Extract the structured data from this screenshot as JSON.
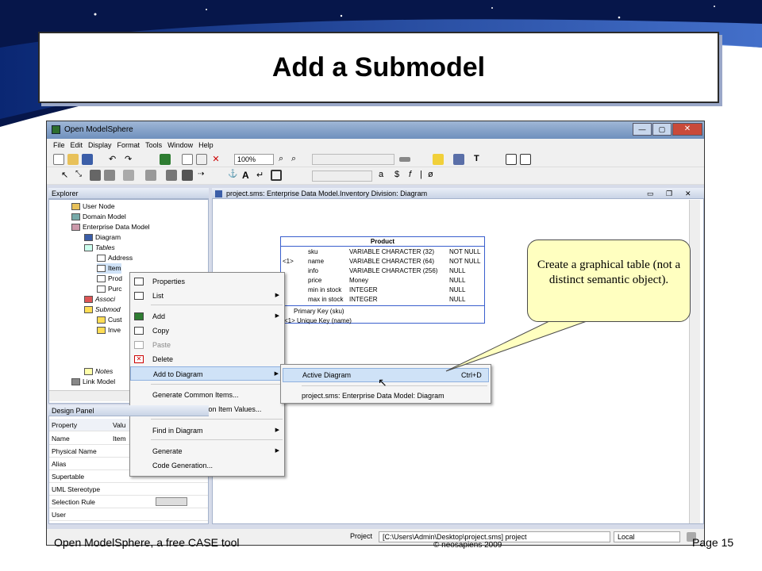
{
  "slide": {
    "title": "Add a Submodel",
    "footer_left": "Open ModelSphere, a free CASE tool",
    "footer_center": "© neosapiens 2009",
    "footer_right": "Page 15"
  },
  "app": {
    "window_title": "Open ModelSphere",
    "menu": [
      "File",
      "Edit",
      "Display",
      "Format",
      "Tools",
      "Window",
      "Help"
    ],
    "zoom": "100%",
    "text_tools": [
      "a",
      "$",
      "f",
      "|",
      "ø"
    ],
    "explorer_title": "Explorer",
    "tree": [
      "User Node",
      "Domain Model",
      "Enterprise Data Model",
      "Diagram",
      "Tables",
      "Address",
      "Item",
      "Prod",
      "Purc",
      "Associ",
      "Submod",
      "Cust",
      "Inve",
      "Notes",
      "Link Model"
    ],
    "design_panel_title": "Design Panel",
    "design_panel": {
      "headers": [
        "Property",
        "Valu"
      ],
      "rows": [
        {
          "name": "Name",
          "value": "Item"
        },
        {
          "name": "Physical Name",
          "value": ""
        },
        {
          "name": "Alias",
          "value": ""
        },
        {
          "name": "Supertable",
          "value": ""
        },
        {
          "name": "UML Stereotype",
          "value": ""
        },
        {
          "name": "Selection Rule",
          "value": ""
        },
        {
          "name": "User",
          "value": ""
        }
      ]
    },
    "diagram_tab": "project.sms: Enterprise Data Model.Inventory Division: Diagram",
    "product_table": {
      "name": "Product",
      "columns": [
        {
          "key": "",
          "name": "sku",
          "type": "VARIABLE CHARACTER (32)",
          "null": "NOT NULL"
        },
        {
          "key": "<1>",
          "name": "name",
          "type": "VARIABLE CHARACTER (64)",
          "null": "NOT NULL"
        },
        {
          "key": "",
          "name": "info",
          "type": "VARIABLE CHARACTER (256)",
          "null": "NULL"
        },
        {
          "key": "",
          "name": "price",
          "type": "Money",
          "null": "NULL"
        },
        {
          "key": "",
          "name": "min in stock",
          "type": "INTEGER",
          "null": "NULL"
        },
        {
          "key": "",
          "name": "max in stock",
          "type": "INTEGER",
          "null": "NULL"
        }
      ],
      "primary_key": "Primary Key (sku)",
      "unique_key": "<1> Unique Key (name)"
    },
    "context_menu": [
      "Properties",
      "List",
      "Add",
      "Copy",
      "Paste",
      "Delete",
      "Add to Diagram",
      "Generate Common Items...",
      "Propagate Common Item Values...",
      "Find in Diagram",
      "Generate",
      "Code Generation..."
    ],
    "submenu": {
      "active_label": "Active Diagram",
      "active_shortcut": "Ctrl+D",
      "other_label": "project.sms: Enterprise Data Model: Diagram"
    },
    "status": {
      "project_label": "Project",
      "project_path": "[C:\\Users\\Admin\\Desktop\\project.sms]  project",
      "local": "Local"
    }
  },
  "callout": "Create a graphical table (not a distinct semantic object).",
  "colors": {
    "accent": "#3a5fcd",
    "callout_bg": "#ffffc0",
    "highlight": "#cfe2f7"
  }
}
